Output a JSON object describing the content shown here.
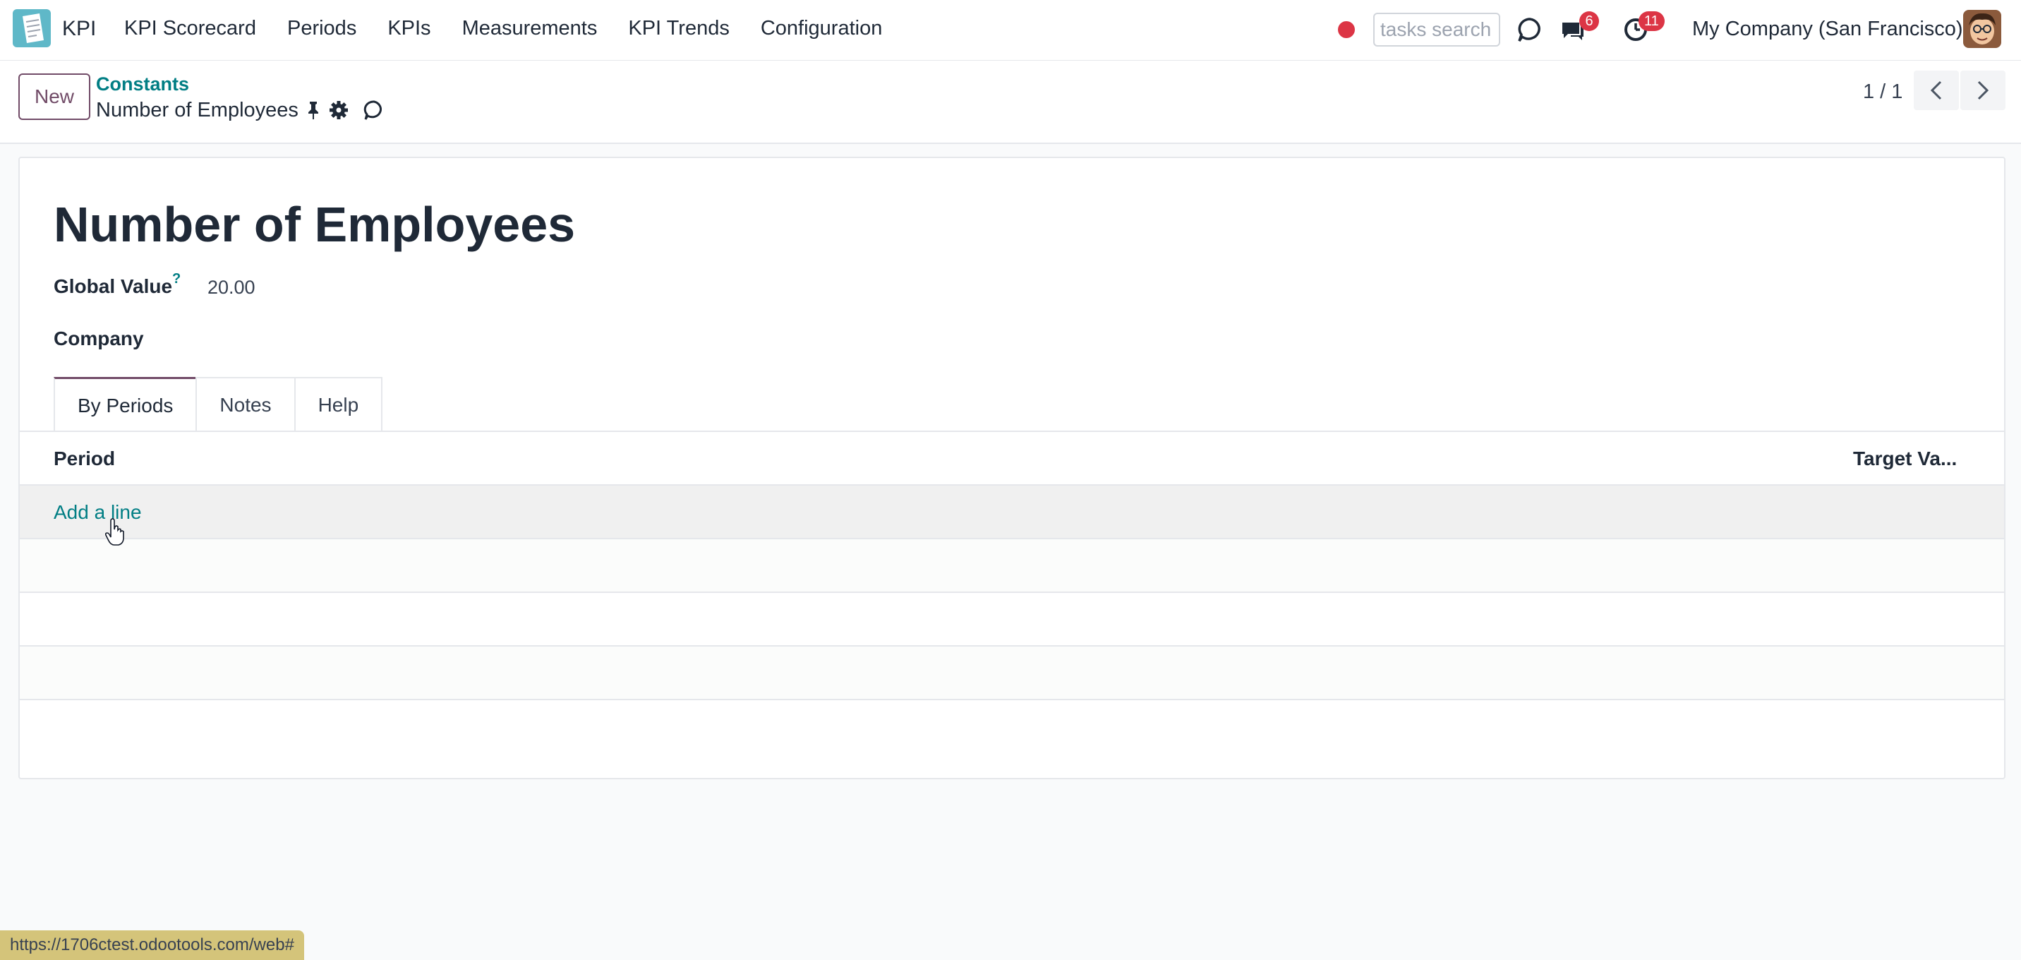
{
  "navbar": {
    "app_name": "KPI",
    "menu": [
      "KPI Scorecard",
      "Periods",
      "KPIs",
      "Measurements",
      "KPI Trends",
      "Configuration"
    ],
    "search_placeholder": "tasks search",
    "messages_count": "6",
    "activities_count": "11",
    "company": "My Company (San Francisco)",
    "icons": [
      "kpi-app-icon",
      "record-dot",
      "chat-bubble-icon",
      "messages-icon",
      "clock-icon",
      "user-avatar"
    ]
  },
  "control_panel": {
    "new_label": "New",
    "breadcrumb_parent": "Constants",
    "breadcrumb_current": "Number of Employees",
    "pager": "1 / 1"
  },
  "form": {
    "title": "Number of Employees",
    "global_value_label": "Global Value",
    "help_marker": "?",
    "global_value": "20.00",
    "company_label": "Company",
    "tabs": [
      "By Periods",
      "Notes",
      "Help"
    ],
    "table": {
      "columns": [
        "Period",
        "Target Va..."
      ],
      "add_line": "Add a line"
    }
  },
  "status_url": "https://1706ctest.odootools.com/web#",
  "colors": {
    "primary": "#714b67",
    "link": "#017e84",
    "badge": "#dc3545"
  }
}
